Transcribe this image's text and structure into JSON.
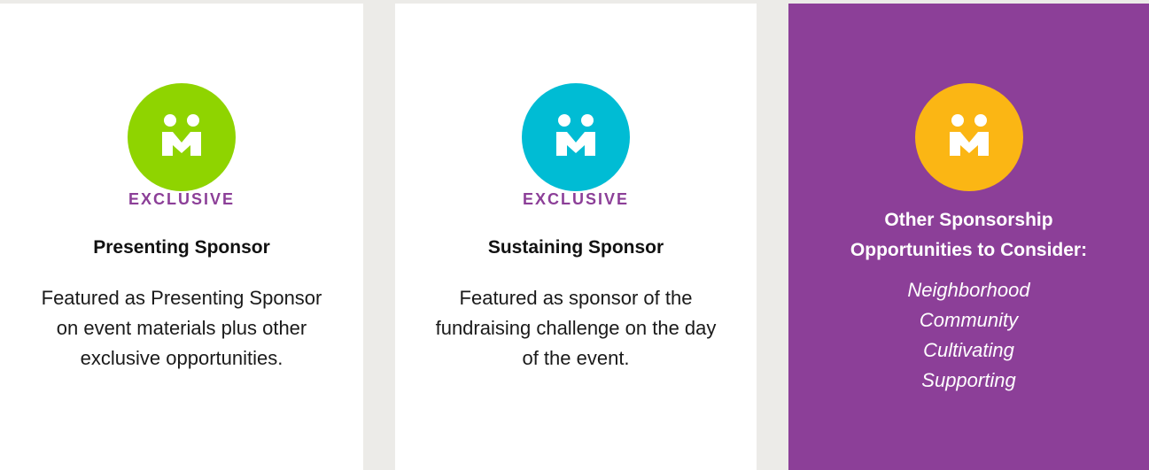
{
  "colors": {
    "green": "#8fd400",
    "cyan": "#00bcd4",
    "yellow": "#fbb614",
    "purple": "#8c3f98",
    "background": "#ecebe8"
  },
  "icon": "people-holding-hands-icon",
  "cards": [
    {
      "eyebrow": "EXCLUSIVE",
      "title": "Presenting Sponsor",
      "description": "Featured as Presenting Sponsor on event materials plus other exclusive opportunities.",
      "badge_color": "#8fd400"
    },
    {
      "eyebrow": "EXCLUSIVE",
      "title": "Sustaining Sponsor",
      "description": "Featured as sponsor of the fundraising challenge on the day of the event.",
      "badge_color": "#00bcd4"
    }
  ],
  "other": {
    "title_line1": "Other Sponsorship",
    "title_line2": "Opportunities to Consider:",
    "badge_color": "#fbb614",
    "items": [
      "Neighborhood",
      "Community",
      "Cultivating",
      "Supporting"
    ]
  }
}
